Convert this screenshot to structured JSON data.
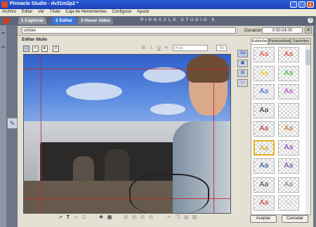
{
  "window": {
    "title": "Pinnacle Studio - dv31m2p2 *"
  },
  "menu": [
    "Archivo",
    "Editar",
    "Ver",
    "Título",
    "Caja de Herramientas",
    "Configurar",
    "Ayuda"
  ],
  "steps": [
    "1 Capturar",
    "2 Editar",
    "3 Hacer vídeo"
  ],
  "brand": "PINNACLE STUDIO 8",
  "help_glyph": "?",
  "name_bar": {
    "name_value": "ombre",
    "duration_label": "Duración:",
    "duration_value": "0:00:04.00",
    "close_glyph": "✕"
  },
  "editor": {
    "title": "Editar título",
    "font_value": "Arial",
    "size_value": "48"
  },
  "styles": {
    "tabs": [
      "Estándar",
      "Personalizar",
      "Favoritos"
    ],
    "swatches": [
      {
        "label": "Aa",
        "color": "#e8403a"
      },
      {
        "label": "Aa",
        "color": "#d63b3b"
      },
      {
        "label": "Aa",
        "color": "#e6c520"
      },
      {
        "label": "Aa",
        "color": "#2fae36"
      },
      {
        "label": "Aa",
        "color": "#3357d6"
      },
      {
        "label": "Aa",
        "color": "#b23bd2"
      },
      {
        "label": "Aa",
        "color": "#222222"
      },
      {
        "label": "",
        "color": "#ffffff"
      },
      {
        "label": "Aa",
        "color": "#b21e1e"
      },
      {
        "label": "Aa",
        "color": "#c06a22"
      },
      {
        "label": "Aa",
        "color": "#c9a21a"
      },
      {
        "label": "Aa",
        "color": "#7a2fbf"
      },
      {
        "label": "Aa",
        "color": "#1c3c9c"
      },
      {
        "label": "Aa",
        "color": "#6a2fa6"
      },
      {
        "label": "Aa",
        "color": "#333333"
      },
      {
        "label": "Aa",
        "color": "#777777"
      },
      {
        "label": "Aa",
        "color": "#c0302a"
      },
      {
        "label": "Aa",
        "color": "#d9d9d9"
      }
    ]
  },
  "buttons": {
    "accept": "Aceptar",
    "cancel": "Cancelar"
  }
}
